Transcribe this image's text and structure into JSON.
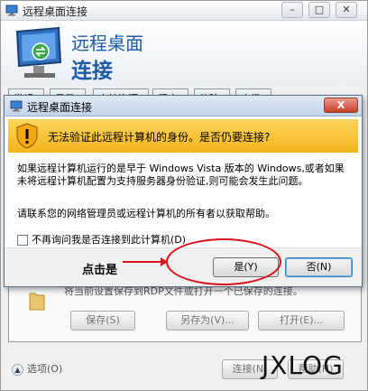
{
  "outer_window": {
    "title": "远程桌面连接",
    "banner_line1": "远程桌面",
    "banner_line2": "连接",
    "tabs": [
      "常规",
      "显示",
      "本地资源",
      "程序",
      "体验",
      "高级"
    ],
    "behind_text": "将当前设置保存到RDP文件或打开一个已保存的连接。",
    "save_label": "保存(S)",
    "saveas_label": "另存为(V)...",
    "open_label": "打开(E)...",
    "options_label": "选项(O)",
    "connect_label": "连接(N)",
    "help_label": "帮助(H)"
  },
  "dialog": {
    "title": "远程桌面连接",
    "close_label": "X",
    "warning_text": "无法验证此远程计算机的身份。是否仍要连接?",
    "body_text": "如果远程计算机运行的是早于 Windows Vista 版本的 Windows,或者如果未将远程计算机配置为支持服务器身份验证,则可能会发生此问题。",
    "body_text2": "请联系您的网络管理员或远程计算机的所有者以获取帮助。",
    "checkbox_label": "不再询问我是否连接到此计算机(D)",
    "checkbox_checked": false,
    "yes_label": "是(Y)",
    "no_label": "否(N)"
  },
  "annotation": {
    "text": "点击是",
    "color": "#d9121a"
  },
  "watermark": "JXLOG",
  "colors": {
    "banner_text": "#1d5aa6",
    "warning_band": "#f4b41f",
    "close_button": "#c9402c"
  }
}
